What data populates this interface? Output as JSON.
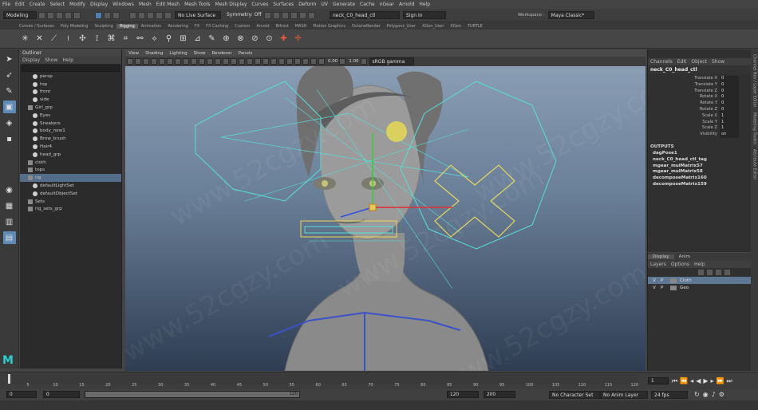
{
  "menubar": [
    "File",
    "Edit",
    "Create",
    "Select",
    "Modify",
    "Display",
    "Windows",
    "Mesh",
    "Edit Mesh",
    "Mesh Tools",
    "Mesh Display",
    "Curves",
    "Surfaces",
    "Deform",
    "UV",
    "Generate",
    "Cache",
    "nGear",
    "Arnold",
    "Help"
  ],
  "workspace": {
    "label": "Workspace :",
    "value": "Maya Classic*"
  },
  "status": {
    "mode": "Modeling",
    "live_surface": "No Live Surface",
    "symmetry": "Symmetry: Off",
    "selected_object": "neck_C0_head_ctl",
    "sign_in": "Sign In"
  },
  "shelf_tabs": [
    "Curves / Surfaces",
    "Poly Modeling",
    "Sculpting",
    "Rigging",
    "Animation",
    "Rendering",
    "FX",
    "FX Caching",
    "Custom",
    "Arnold",
    "Bifrost",
    "MASH",
    "Motion Graphics",
    "OctaneRender",
    "Polygons_User",
    "XGen_User",
    "XGen",
    "TURTLE"
  ],
  "shelf_active": "Rigging",
  "outliner": {
    "title": "Outliner",
    "menu": [
      "Display",
      "Show",
      "Help"
    ],
    "items": [
      {
        "label": "persp",
        "indent": 2
      },
      {
        "label": "top",
        "indent": 2
      },
      {
        "label": "front",
        "indent": 2
      },
      {
        "label": "side",
        "indent": 2
      },
      {
        "label": "Girl_grp",
        "indent": 1
      },
      {
        "label": "Eyes",
        "indent": 2
      },
      {
        "label": "Sneakers",
        "indent": 2
      },
      {
        "label": "body_new1",
        "indent": 2
      },
      {
        "label": "Brow_brush",
        "indent": 2
      },
      {
        "label": "Hair4",
        "indent": 2
      },
      {
        "label": "head_grp",
        "indent": 2
      },
      {
        "label": "cloth",
        "indent": 1
      },
      {
        "label": "tops",
        "indent": 1
      },
      {
        "label": "rig",
        "indent": 1,
        "selected": true
      },
      {
        "label": "defaultLightSet",
        "indent": 2
      },
      {
        "label": "defaultObjectSet",
        "indent": 2
      },
      {
        "label": "Sets",
        "indent": 1
      },
      {
        "label": "rig_sets_grp",
        "indent": 1
      }
    ]
  },
  "viewport": {
    "menu": [
      "View",
      "Shading",
      "Lighting",
      "Show",
      "Renderer",
      "Panels"
    ],
    "field1": "0.00",
    "field2": "1.00",
    "colorspace": "sRGB gamma"
  },
  "channel_box": {
    "menu": [
      "Channels",
      "Edit",
      "Object",
      "Show"
    ],
    "object": "neck_C0_head_ctl",
    "attributes": [
      {
        "name": "Translate X",
        "value": "0"
      },
      {
        "name": "Translate Y",
        "value": "0"
      },
      {
        "name": "Translate Z",
        "value": "0"
      },
      {
        "name": "Rotate X",
        "value": "0"
      },
      {
        "name": "Rotate Y",
        "value": "0"
      },
      {
        "name": "Rotate Z",
        "value": "0"
      },
      {
        "name": "Scale X",
        "value": "1"
      },
      {
        "name": "Scale Y",
        "value": "1"
      },
      {
        "name": "Scale Z",
        "value": "1"
      },
      {
        "name": "Visibility",
        "value": "on"
      }
    ],
    "outputs_label": "OUTPUTS",
    "outputs": [
      "dagPose1",
      "neck_C0_head_ctl_tag",
      "mgear_mulMatrix57",
      "mgear_mulMatrix58",
      "decomposeMatrix160",
      "decomposeMatrix159"
    ]
  },
  "layers": {
    "tabs": [
      "Display",
      "Anim"
    ],
    "menu": [
      "Layers",
      "Options",
      "Help"
    ],
    "rows": [
      {
        "v": "V",
        "p": "P",
        "name": "Cloth",
        "selected": true
      },
      {
        "v": "V",
        "p": "P",
        "name": "Geo",
        "selected": false
      }
    ]
  },
  "side_tabs": [
    "Channel Box / Layer Editor",
    "Modeling Toolkit",
    "Attribute Editor"
  ],
  "timeline": {
    "ticks": [
      "5",
      "10",
      "15",
      "20",
      "25",
      "30",
      "35",
      "40",
      "45",
      "50",
      "55",
      "60",
      "65",
      "70",
      "75",
      "80",
      "85",
      "90",
      "95",
      "100",
      "105",
      "110",
      "115",
      "120"
    ],
    "current_frame": "1"
  },
  "range": {
    "start": "0",
    "anim_start": "0",
    "range_end": "120",
    "end": "120",
    "anim_end": "200",
    "character_set": "No Character Set",
    "anim_layer": "No Anim Layer",
    "fps": "24 fps"
  },
  "watermark_text": "www.52cgzy.com",
  "colors": {
    "accent": "#5d8bb5",
    "rig_cyan": "#55e0d8",
    "rig_yellow": "#e8d75a"
  }
}
